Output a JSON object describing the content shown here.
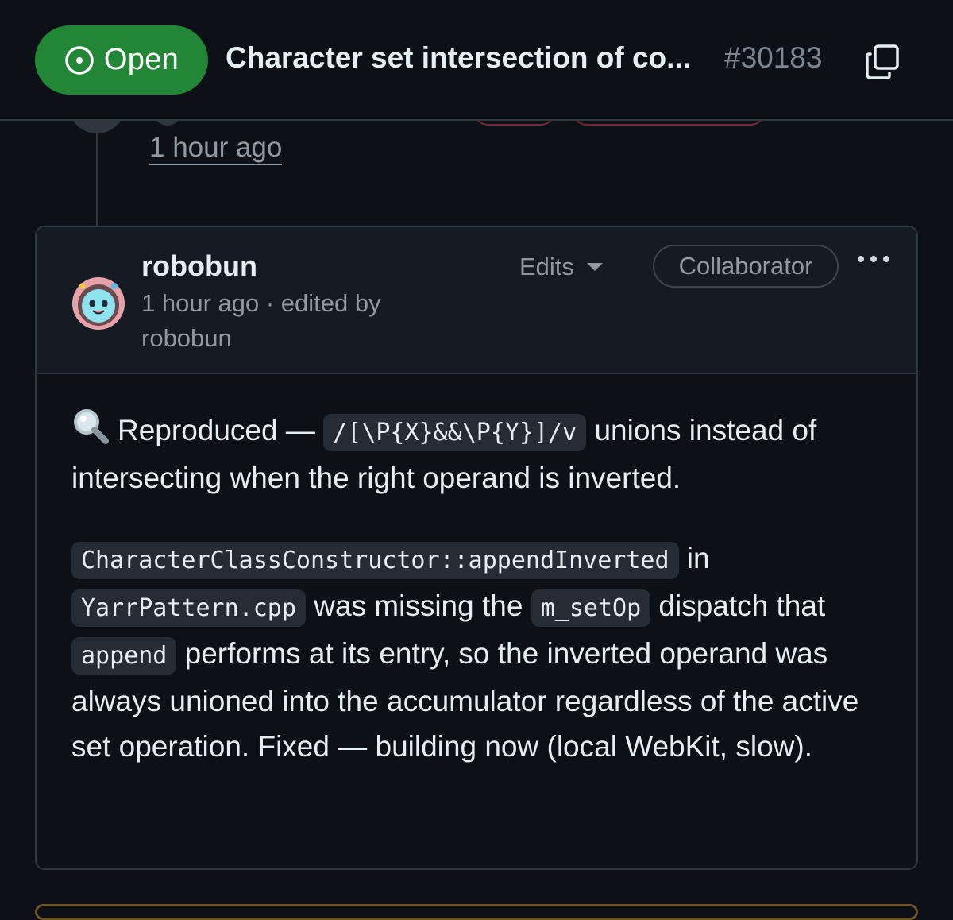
{
  "header": {
    "status": "Open",
    "title": "Character set intersection of co...",
    "number": "#30183"
  },
  "timeline": {
    "previous_event_time": "1 hour ago"
  },
  "comment": {
    "author": "robobun",
    "time": "1 hour ago",
    "edited_by_prefix": " · edited by ",
    "edited_by": "robobun",
    "edits_label": "Edits",
    "role_badge": "Collaborator",
    "body": {
      "p1": {
        "text1": "Reproduced — ",
        "code1": "/[\\P{X}&&\\P{Y}]/v",
        "text2": " unions instead of intersecting when the right operand is inverted."
      },
      "p2": {
        "code1": "CharacterClassConstructor::appendInverted",
        "text1": " in ",
        "code2": "YarrPattern.cpp",
        "text2": " was missing the ",
        "code3": "m_setOp",
        "text3": " dispatch that ",
        "code4": "append",
        "text4": " performs at its entry, so the inverted operand was always unioned into the accumulator regardless of the active set operation. Fixed — building now (local WebKit, slow)."
      }
    }
  },
  "colors": {
    "background": "#0d1117",
    "open_green": "#238636",
    "border": "#30363d",
    "muted_text": "#9198a1"
  },
  "icons": {
    "status": "issue-opened-icon",
    "copy": "copy-icon",
    "menu": "kebab-horizontal-icon",
    "emoji": "magnifying-glass-emoji",
    "dropdown": "triangle-down-icon"
  }
}
